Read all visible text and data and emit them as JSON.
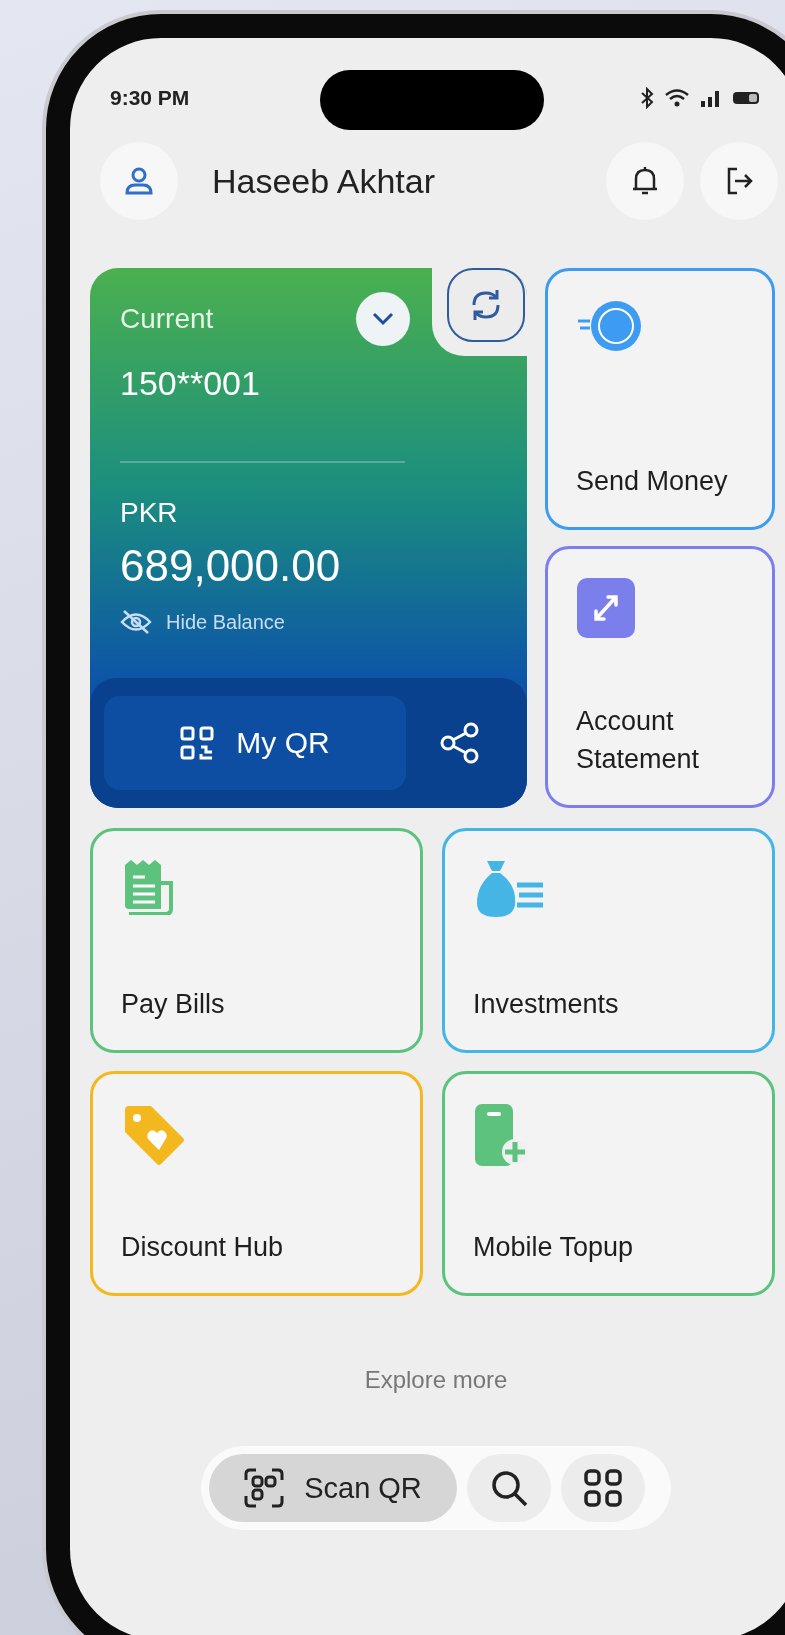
{
  "status_bar": {
    "time": "9:30 PM"
  },
  "header": {
    "user_name": "Haseeb Akhtar"
  },
  "account_card": {
    "account_type": "Current",
    "account_number": "150**001",
    "currency": "PKR",
    "balance": "689,000.00",
    "hide_balance_label": "Hide Balance",
    "qr_button": "My QR"
  },
  "side_tiles": [
    {
      "kind": "send",
      "label": "Send Money",
      "color": "#3d9cf2"
    },
    {
      "kind": "statement",
      "label": "Account Statement",
      "color": "#7b7fec"
    }
  ],
  "grid_tiles": [
    {
      "kind": "bills",
      "label": "Pay Bills",
      "color": "#5cc27e"
    },
    {
      "kind": "invest",
      "label": "Investments",
      "color": "#45b5e6"
    },
    {
      "kind": "discount",
      "label": "Discount Hub",
      "color": "#f2b81e"
    },
    {
      "kind": "topup",
      "label": "Mobile Topup",
      "color": "#5cc27e"
    }
  ],
  "explore_label": "Explore more",
  "bottom_bar": [
    {
      "kind": "scan",
      "label": "Scan QR",
      "selected": true
    },
    {
      "kind": "search",
      "selected": false
    },
    {
      "kind": "apps",
      "selected": false
    }
  ]
}
